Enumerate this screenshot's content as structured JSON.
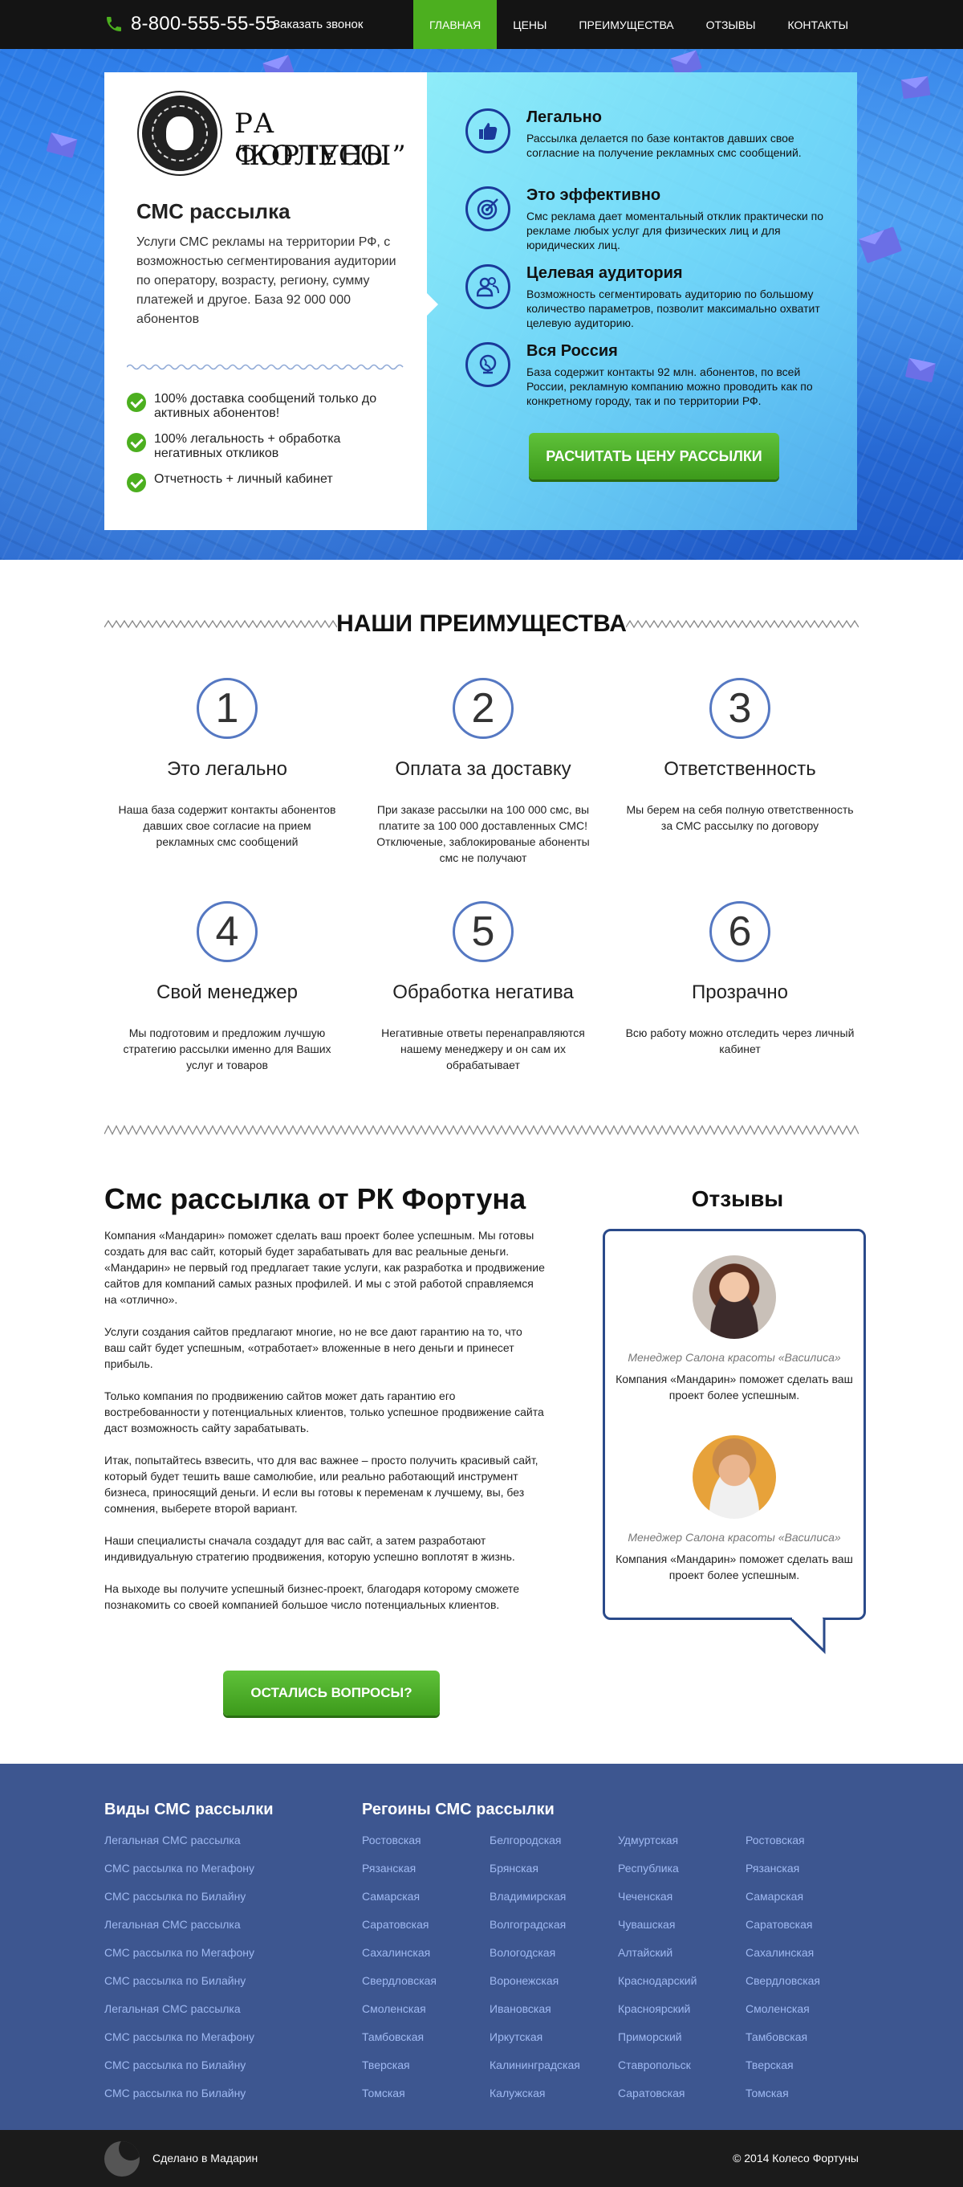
{
  "header": {
    "phone": "8-800-555-55-55",
    "callback": "Заказать звонок",
    "nav": [
      "ГЛАВНАЯ",
      "ЦЕНЫ",
      "ПРЕИМУЩЕСТВА",
      "ОТЗЫВЫ",
      "КОНТАКТЫ"
    ],
    "active_nav": "ГЛАВНАЯ",
    "colors": {
      "bar": "#141414",
      "active": "#4caf1f"
    }
  },
  "hero": {
    "brand_line1": "РА “КОЛЕСО",
    "brand_line2": "ФОРТУНЫ”",
    "title": "СМС рассылка",
    "description": "Услуги СМС рекламы на территории РФ, с возможностью сегментирования аудитории по оператору, возрасту, региону, сумму платежей и другое. База 92 000 000 абонентов",
    "checks": [
      "100% доставка сообщений только до активных абонентов!",
      "100% легальность + обработка негативных откликов",
      "Отчетность + личный кабинет"
    ],
    "features": [
      {
        "icon": "thumbs-up-icon",
        "title": "Легально",
        "text": "Рассылка делается по базе контактов давших свое согласние на получение рекламных смс сообщений."
      },
      {
        "icon": "target-icon",
        "title": "Это эффективно",
        "text": "Смс реклама дает моментальный отклик практически по рекламе любых услуг для физических лиц и для юридических лиц."
      },
      {
        "icon": "people-icon",
        "title": "Целевая аудитория",
        "text": "Возможность сегментировать аудиторию по большому количество параметров, позволит максимально охватит целевую аудиторию."
      },
      {
        "icon": "globe-icon",
        "title": "Вся Россия",
        "text": "База содержит контакты 92 млн. абонентов, по всей России, рекламную компанию можно проводить как по конкретному городу, так и по территории РФ."
      }
    ],
    "cta": "РАСЧИТАТЬ ЦЕНУ РАССЫЛКИ"
  },
  "advantages": {
    "title": "НАШИ ПРЕИМУЩЕСТВА",
    "items": [
      {
        "num": "1",
        "title": "Это легально",
        "text": "Наша база содержит контакты абонентов давших свое согласие на прием рекламных смс сообщений"
      },
      {
        "num": "2",
        "title": "Оплата за доставку",
        "text": "При заказе рассылки на 100 000 смс, вы платите за 100 000 доставленных СМС! Отключеные, заблокированые абоненты смс не получают"
      },
      {
        "num": "3",
        "title": "Ответственность",
        "text": "Мы берем на себя полную ответственность за СМС рассылку по договору"
      },
      {
        "num": "4",
        "title": "Свой менеджер",
        "text": "Мы подготовим и предложим лучшую стратегию рассылки именно для Ваших услуг и товаров"
      },
      {
        "num": "5",
        "title": "Обработка негатива",
        "text": "Негативные ответы перенаправляются нашему менеджеру и он сам их обрабатывает"
      },
      {
        "num": "6",
        "title": "Прозрачно",
        "text": "Всю работу можно отследить через личный кабинет"
      }
    ]
  },
  "about": {
    "title": "Смс рассылка от РК Фортуна",
    "paragraphs": [
      "Компания «Мандарин» поможет сделать ваш проект более успешным. Мы готовы создать для вас сайт, который будет зарабатывать для вас реальные деньги. «Мандарин» не первый год предлагает такие услуги, как разработка и продвижение сайтов для компаний самых разных профилей. И мы с этой работой справляемся на «отлично».",
      "Услуги создания сайтов предлагают многие, но не все дают гарантию на то, что ваш сайт будет успешным, «отработает» вложенные в него деньги и принесет прибыль.",
      "Только компания по продвижению сайтов может дать гарантию его востребованности у потенциальных клиентов, только успешное продвижение сайта даст возможность сайту зарабатывать.",
      "Итак, попытайтесь взвесить, что для вас важнее – просто получить красивый сайт, который будет тешить ваше самолюбие, или реально работающий инструмент бизнеса, приносящий деньги. И если вы готовы к переменам к лучшему, вы, без сомнения, выберете второй вариант.",
      "Наши специалисты сначала создадут для вас сайт, а затем разработают индивидуальную стратегию продвижения, которую успешно воплотят в жизнь.",
      "На выходе вы получите успешный бизнес-проект, благодаря которому сможете познакомить со своей компанией большое число потенциальных клиентов."
    ],
    "cta": "ОСТАЛИСЬ ВОПРОСЫ?"
  },
  "reviews": {
    "title": "Отзывы",
    "items": [
      {
        "role": "Менеджер Салона красоты «Василиса»",
        "text": "Компания «Мандарин» поможет сделать ваш проект более успешным."
      },
      {
        "role": "Менеджер Салона красоты «Василиса»",
        "text": "Компания «Мандарин» поможет сделать ваш проект более успешным."
      }
    ]
  },
  "footer": {
    "types_title": "Виды СМС рассылки",
    "types": [
      "Легальная СМС рассылка",
      "СМС рассылка по Мегафону",
      "СМС рассылка по Билайну",
      "Легальная СМС рассылка",
      "СМС рассылка по Мегафону",
      "СМС рассылка по Билайну",
      "Легальная СМС рассылка",
      "СМС рассылка по Мегафону",
      "СМС рассылка по Билайну",
      "СМС рассылка по Билайну"
    ],
    "regions_title": "Регоины СМС рассылки",
    "regions": [
      [
        "Ростовская",
        "Рязанская",
        "Самарская",
        "Саратовская",
        "Сахалинская",
        "Свердловская",
        "Смоленская",
        "Тамбовская",
        "Тверская",
        "Томская"
      ],
      [
        "Белгородская",
        "Брянская",
        "Владимирская",
        "Волгоградская",
        "Вологодская",
        "Воронежская",
        "Ивановская",
        "Иркутская",
        "Калининградская",
        "Калужская"
      ],
      [
        "Удмуртская",
        "Республика",
        "Чеченская",
        "Чувашская",
        "Алтайский",
        "Краснодарский",
        "Красноярский",
        "Приморский",
        "Ставропольск",
        "Саратовская"
      ],
      [
        "Ростовская",
        "Рязанская",
        "Самарская",
        "Саратовская",
        "Сахалинская",
        "Свердловская",
        "Смоленская",
        "Тамбовская",
        "Тверская",
        "Томская"
      ]
    ],
    "made_by": "Сделано в Мадарин",
    "copyright": "© 2014 Колесо Фортуны",
    "colors": {
      "background": "#3d5690",
      "link": "#9fb9f2",
      "bottom": "#1b1b1b"
    }
  }
}
